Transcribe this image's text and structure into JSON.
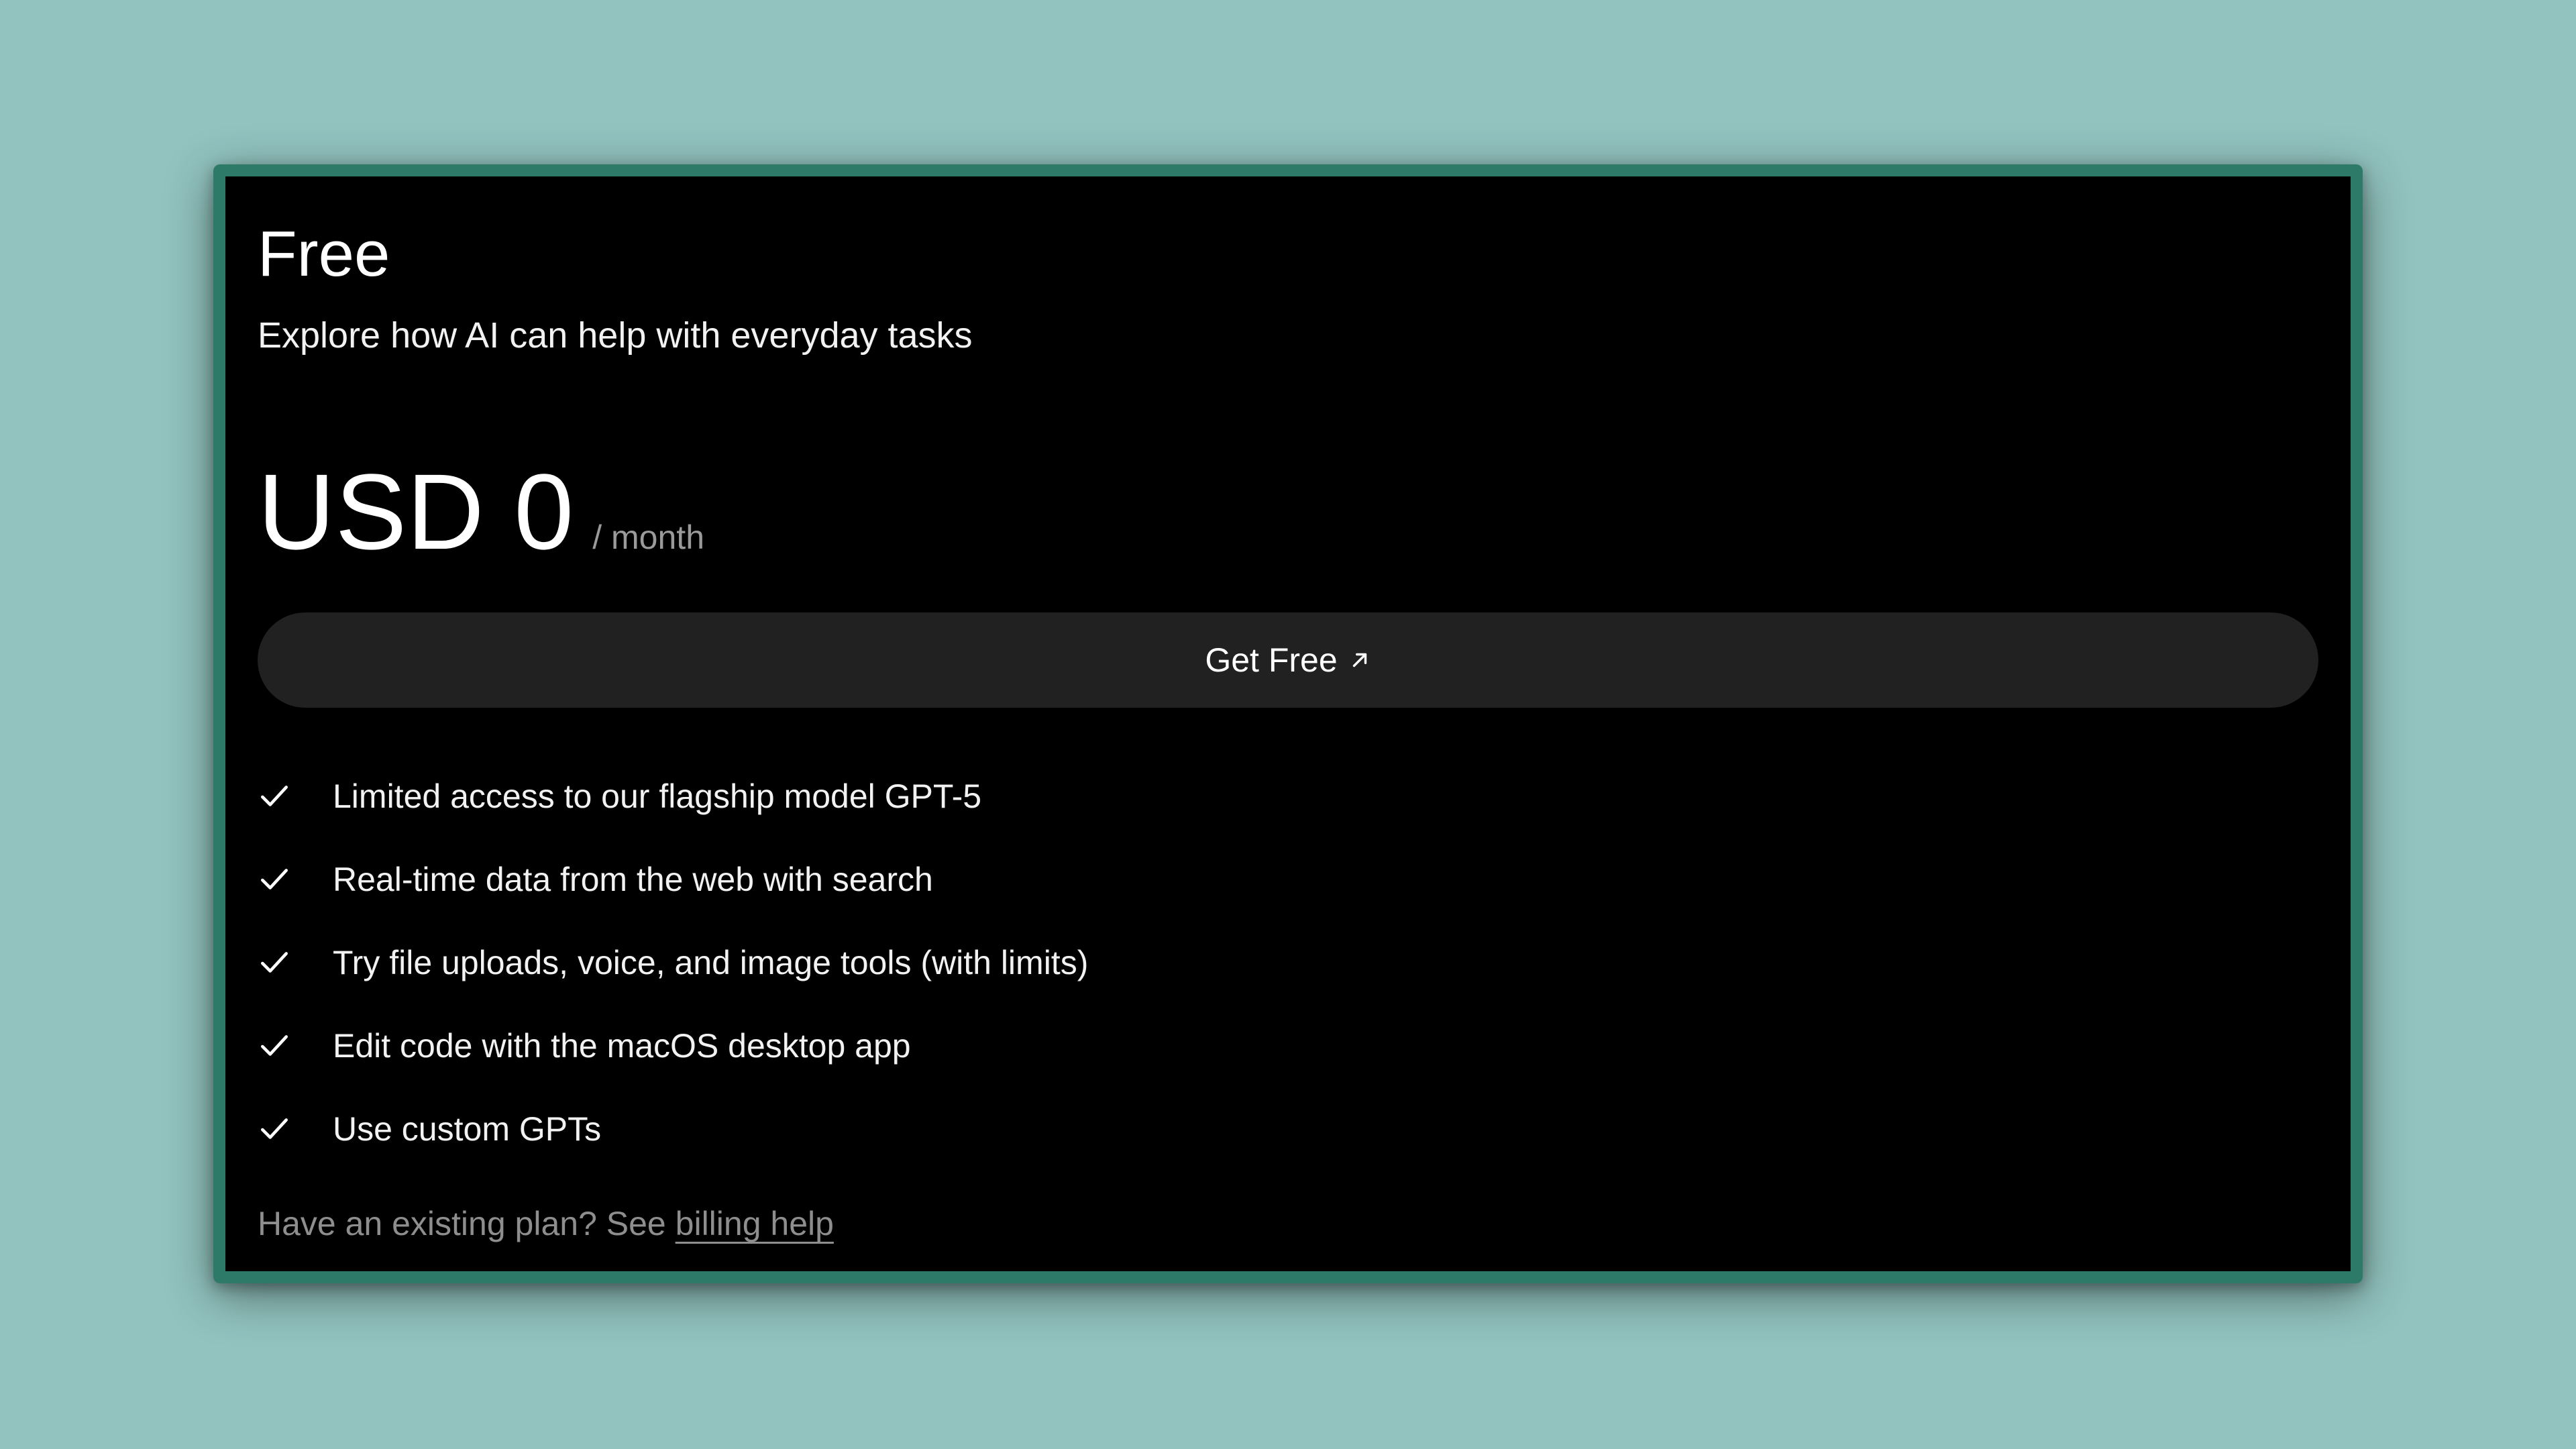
{
  "plan": {
    "title": "Free",
    "subtitle": "Explore how AI can help with everyday tasks",
    "price": "USD 0",
    "period": "/ month"
  },
  "cta": {
    "label": "Get Free",
    "icon": "arrow-up-right-icon"
  },
  "features": [
    {
      "icon": "check-icon",
      "label": "Limited access to our flagship model GPT-5"
    },
    {
      "icon": "check-icon",
      "label": "Real-time data from the web with search"
    },
    {
      "icon": "check-icon",
      "label": "Try file uploads, voice, and image tools (with limits)"
    },
    {
      "icon": "check-icon",
      "label": "Edit code with the macOS desktop app"
    },
    {
      "icon": "check-icon",
      "label": "Use custom GPTs"
    }
  ],
  "footer": {
    "prefix": "Have an existing plan? See",
    "link_label": "billing help"
  },
  "colors": {
    "background": "#92c3bf",
    "frame_border": "#2e7a68",
    "card": "#000000",
    "button": "#212121",
    "muted_text": "#8e8e8e"
  }
}
